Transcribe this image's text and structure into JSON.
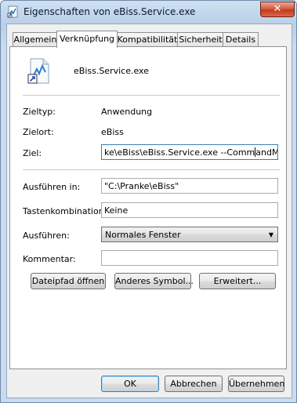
{
  "window": {
    "title": "Eigenschaften von eBiss.Service.exe",
    "close_glyph": "✕",
    "accent": "#3c7fb1"
  },
  "tabs": [
    {
      "label": "Allgemein"
    },
    {
      "label": "Verknüpfung"
    },
    {
      "label": "Kompatibilität"
    },
    {
      "label": "Sicherheit"
    },
    {
      "label": "Details"
    }
  ],
  "active_tab": "Verknüpfung",
  "shortcut": {
    "file_name": "eBiss.Service.exe",
    "file_icon": "shortcut-icon",
    "target_type_label": "Zieltyp:",
    "target_type_value": "Anwendung",
    "target_location_label": "Zielort:",
    "target_location_value": "eBiss",
    "target_label": "Ziel:",
    "target_value_before_caret": "ke\\eBiss\\eBiss.Service.exe --Comm",
    "target_value_after_caret": "andMode\"",
    "start_in_label": "Ausführen in:",
    "start_in_value": "\"C:\\Pranke\\eBiss\"",
    "shortcut_key_label": "Tastenkombination:",
    "shortcut_key_value": "Keine",
    "run_label": "Ausführen:",
    "run_value": "Normales Fenster",
    "comment_label": "Kommentar:",
    "comment_value": ""
  },
  "buttons": {
    "open_file_location": "Dateipfad öffnen",
    "change_icon": "Anderes Symbol...",
    "advanced": "Erweitert...",
    "ok": "OK",
    "cancel": "Abbrechen",
    "apply": "Übernehmen"
  }
}
